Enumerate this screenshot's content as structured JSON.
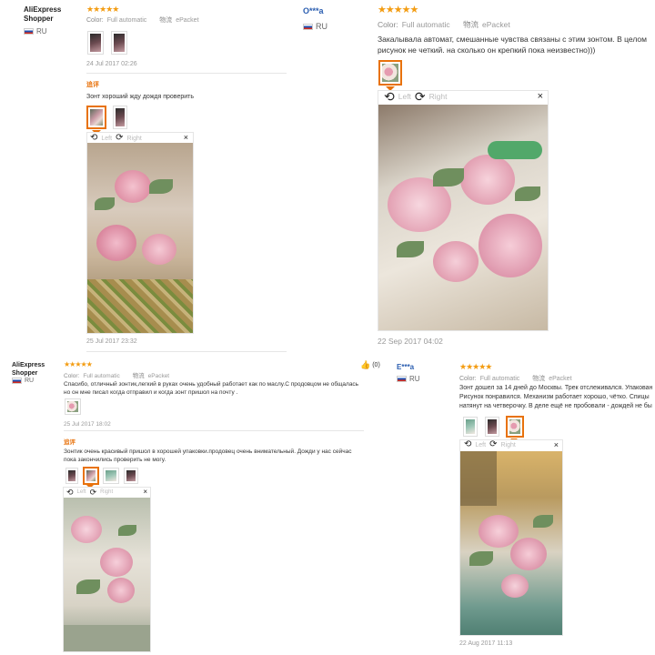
{
  "icons": {
    "star": "★",
    "thumb_up": "👍",
    "rotate_left": "⟲",
    "rotate_right": "⟳",
    "close": "×"
  },
  "colors": {
    "accent": "#e8720c",
    "stars": "#f39c12",
    "username_blue": "#2a5db0"
  },
  "panels": [
    {
      "user": "AliExpress Shopper",
      "country": "RU",
      "stars": "★★★★★",
      "color_label": "Color:",
      "color_value": "Full automatic",
      "shipping_label": "物流",
      "shipping_value": "ePacket",
      "date": "24 Jul 2017 02:26",
      "additional_label": "追评",
      "additional_text": "Зонт хороший жду дождя проверить",
      "viewer_left": "Left",
      "viewer_right": "Right",
      "additional_date": "25 Jul 2017 23:32"
    },
    {
      "user": "O***a",
      "country": "RU",
      "stars": "★★★★★",
      "color_label": "Color:",
      "color_value": "Full automatic",
      "shipping_label": "物流",
      "shipping_value": "ePacket",
      "text": "Закалывала автомат, смешанные чувства связаны с этим зонтом. В целом рисунок не четкий. на сколько он крепкий пока неизвестно)))",
      "viewer_left": "Left",
      "viewer_right": "Right",
      "date": "22 Sep 2017 04:02"
    },
    {
      "user": "AliExpress Shopper",
      "country": "RU",
      "stars": "★★★★★",
      "color_label": "Color:",
      "color_value": "Full automatic",
      "shipping_label": "物流",
      "shipping_value": "ePacket",
      "helpful_count": "(0)",
      "text": "Спасибо, отличный зонтик,легкий в руках очень удобный работает как по маслу.С продовцом не общалась но он мне писал когда отправил и когда зонт пришол на почту .",
      "date": "25 Jul 2017 18:02",
      "additional_label": "追评",
      "additional_text": "Зонтик очень красивый пришол в хорошей упаковки.продовец очень внимательный. Дожди у нас сейчас пока закончились проверить не могу.",
      "viewer_left": "Left",
      "viewer_right": "Right"
    },
    {
      "user": "E***a",
      "country": "RU",
      "stars": "★★★★★",
      "color_label": "Color:",
      "color_value": "Full automatic",
      "shipping_label": "物流",
      "shipping_value": "ePacket",
      "text": "Зонт дошел за 14 дней до Москвы. Трек отслеживался. Упакован Рисунок понравился. Механизм работает хорошо, чётко. Спицы натянут на четверочку. В деле ещё не пробовали - дождей не бы",
      "viewer_left": "Left",
      "viewer_right": "Right",
      "date": "22 Aug 2017 11:13"
    }
  ]
}
